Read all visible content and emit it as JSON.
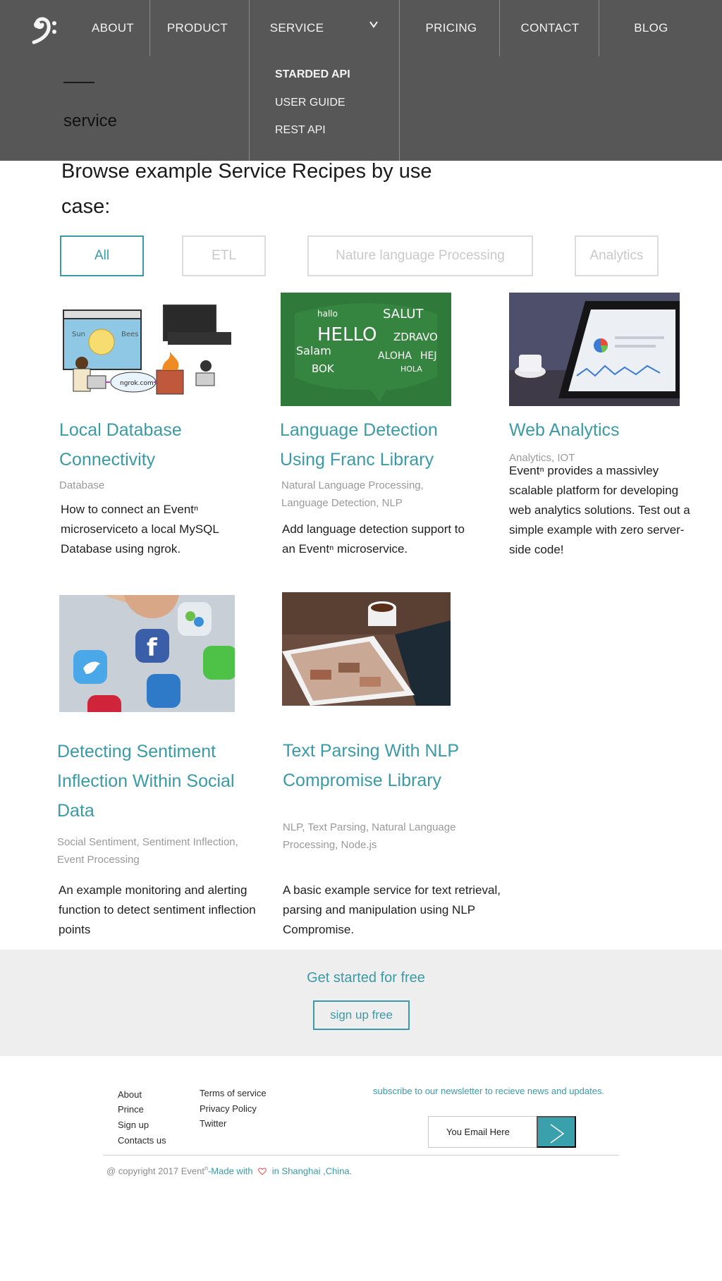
{
  "nav": {
    "items": [
      {
        "label": "ABOUT"
      },
      {
        "label": "PRODUCT"
      },
      {
        "label": "SERVICE"
      },
      {
        "label": "PRICING"
      },
      {
        "label": "CONTACT"
      },
      {
        "label": "BLOG"
      }
    ],
    "dropdown": [
      {
        "label": "STARDED API"
      },
      {
        "label": "USER GUIDE"
      },
      {
        "label": "REST API"
      }
    ]
  },
  "breadcrumb": {
    "label": "service"
  },
  "intro": {
    "heading": "Browse example Service Recipes by use case:"
  },
  "filters": [
    {
      "label": "All",
      "active": true
    },
    {
      "label": "ETL",
      "active": false
    },
    {
      "label": "Nature language Processing",
      "active": false
    },
    {
      "label": "Analytics",
      "active": false
    }
  ],
  "cards": [
    {
      "title": "Local Database Connectivity",
      "tags": "Database",
      "description": "How to connect an Eventⁿ microserviceto a local MySQL Database using ngrok."
    },
    {
      "title": "Language Detection Using Franc Library",
      "tags": "Natural Language Processing, Language Detection, NLP",
      "description": "Add language detection support to an Eventⁿ microservice."
    },
    {
      "title": "Web Analytics",
      "tags": "Analytics, IOT",
      "description": "Eventⁿ provides a massivley scalable platform for developing web analytics solutions. Test out a simple example with zero server-side code!"
    },
    {
      "title": "Detecting Sentiment Inflection Within Social Data",
      "tags": "Social Sentiment, Sentiment Inflection, Event Processing",
      "description": "An example monitoring and alerting function to detect sentiment inflection points"
    },
    {
      "title": "Text Parsing With NLP Compromise Library",
      "tags": "NLP, Text Parsing, Natural Language Processing, Node.js",
      "description": "A basic example service for text retrieval, parsing and manipulation using NLP Compromise."
    }
  ],
  "thumb_text": {
    "ngrok": "ngrok.com",
    "sun": "Sun",
    "bees": "Bees",
    "hello": "HELLO",
    "salut": "SALUT",
    "salam": "Salam",
    "zdravo": "ZDRAVO",
    "aloha": "ALOHA",
    "bok": "BOK",
    "hej": "HEJ",
    "hola": "HOLA",
    "hallo": "hallo"
  },
  "cta": {
    "title": "Get started for free",
    "button": "sign up free"
  },
  "footer": {
    "col1": [
      "About",
      "Prince",
      "Sign up",
      "Contacts us"
    ],
    "col2": [
      "Terms of service",
      "Privacy Policy",
      "Twitter"
    ],
    "newsletter": "subscribe to our newsletter  to recieve news and updates.",
    "email_value": "You Email Here",
    "copy_prefix": "@ copyright 2017 Event",
    "copy_sup": "n",
    "copy_made": "-Made with",
    "copy_location": "in Shanghai ,China."
  },
  "colors": {
    "accent": "#3a9aa6",
    "header_bg": "#575757",
    "cta_bg": "#eeeeee"
  },
  "icons": {
    "logo": "bass-clef-icon",
    "dropdown": "chevron-down-icon",
    "submit": "arrow-right-icon",
    "love": "heart-icon"
  }
}
